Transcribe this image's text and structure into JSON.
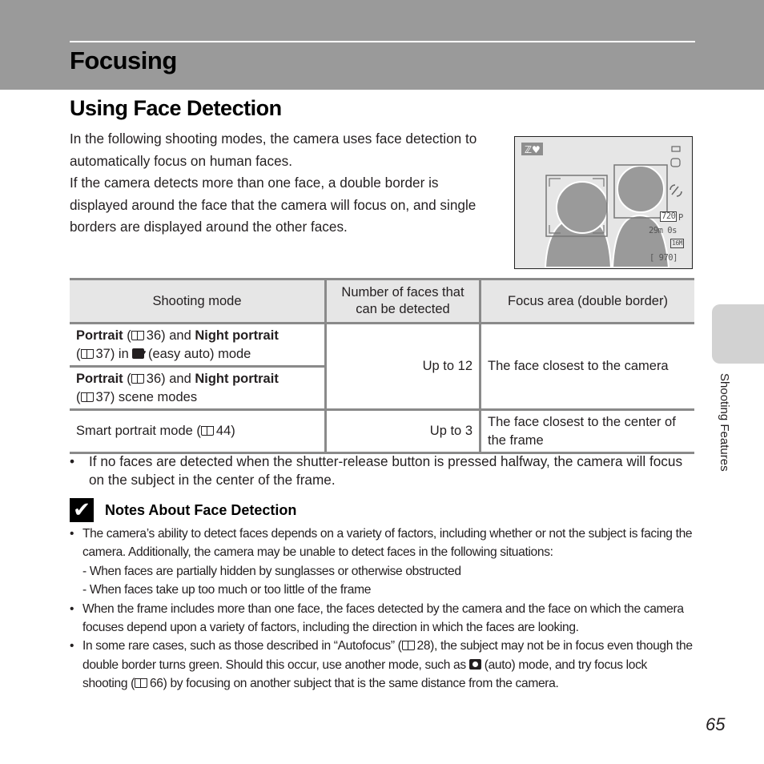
{
  "chapter": {
    "title": "Focusing"
  },
  "section": {
    "title": "Using Face Detection"
  },
  "intro": {
    "p1": "In the following shooting modes, the camera uses face detection to automatically focus on human faces.",
    "p2": "If the camera detects more than one face, a double border is displayed around the face that the camera will focus on, and single borders are displayed around the other faces."
  },
  "screen": {
    "mode_icon": "smart-portrait-icon",
    "movie_quality": "720",
    "movie_suffix": "P",
    "remaining_time": "29m 0s",
    "image_size": "16M",
    "remaining_shots": "[ 970]"
  },
  "table": {
    "headers": [
      "Shooting mode",
      "Number of faces that can be detected",
      "Focus area (double border)"
    ],
    "rows": [
      {
        "mode_bold1": "Portrait",
        "mode_ref1": "36) and ",
        "mode_bold2": "Night portrait",
        "mode_ref2": "37) in ",
        "mode_tail": " (easy auto) mode"
      },
      {
        "mode_bold1": "Portrait",
        "mode_ref1": "36) and ",
        "mode_bold2": "Night portrait",
        "mode_ref2": "37) scene modes"
      },
      {
        "mode": "Smart portrait mode (",
        "mode_ref": "44)"
      }
    ],
    "count_a": "Up to 12",
    "focus_a": "The face closest to the camera",
    "count_b": "Up to 3",
    "focus_b": "The face closest to the center of the frame"
  },
  "bullet": "If no faces are detected when the shutter-release button is pressed halfway, the camera will focus on the subject in the center of the frame.",
  "notes": {
    "title": "Notes About Face Detection",
    "n1": "The camera’s ability to detect faces depends on a variety of factors, including whether or not the subject is facing the camera. Additionally, the camera may be unable to detect faces in the following situations:",
    "n1_sub1": "-  When faces are partially hidden by sunglasses or otherwise obstructed",
    "n1_sub2": "-  When faces take up too much or too little of the frame",
    "n2": "When the frame includes more than one face, the faces detected by the camera and the face on which the camera focuses depend upon a variety of factors, including the direction in which the faces are looking.",
    "n3_a": "In some rare cases, such as those described in “Autofocus” (",
    "n3_b": "28), the subject may not be in focus even though the double border turns green. Should this occur, use another mode, such as ",
    "n3_c": " (auto) mode, and try focus lock shooting (",
    "n3_d": "66) by focusing on another subject that is the same distance from the camera."
  },
  "side_tab": {
    "label": "Shooting Features"
  },
  "page_number": "65"
}
